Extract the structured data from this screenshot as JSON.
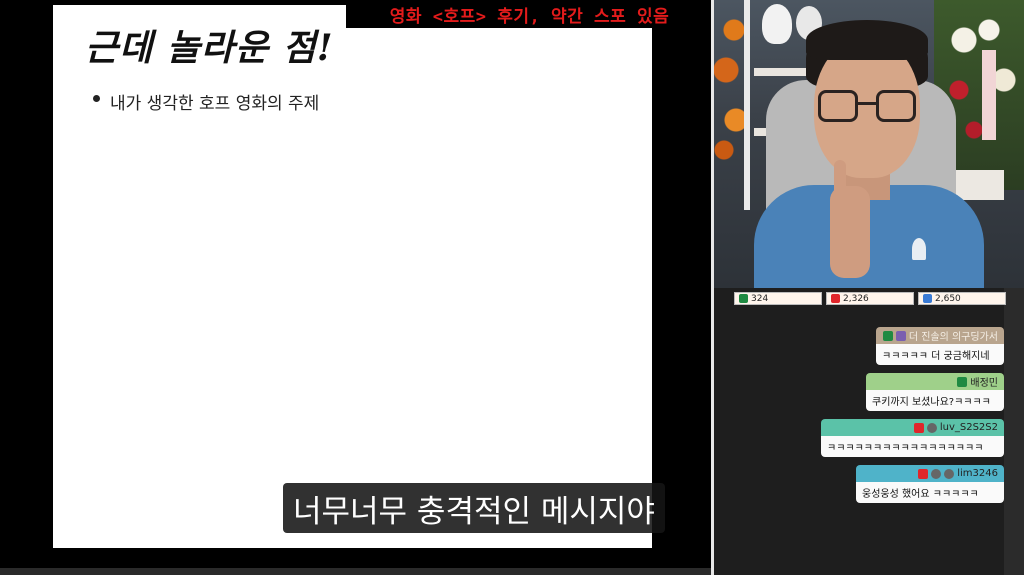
{
  "slide": {
    "title": "근데 놀라운 점!",
    "bullets": [
      "내가 생각한 호프 영화의 주제"
    ]
  },
  "banner": "영화 <호프> 후기, 약간 스포 있음",
  "subtitle": "너무너무 충격적인 메시지야",
  "stats": [
    {
      "icon": "chzzk-icon",
      "value": "324",
      "color": "#1f8a42"
    },
    {
      "icon": "youtube-icon",
      "value": "2,326",
      "color": "#e0262b"
    },
    {
      "icon": "soop-icon",
      "value": "2,650",
      "color": "#3a7bd5"
    }
  ],
  "chat": [
    {
      "user": "더 진솔의 의구딩가서",
      "message": "ㅋㅋㅋㅋㅋ 더 궁금해지네",
      "head_color": "#b9a58e",
      "platform_icons": [
        "chzzk-icon",
        "badge-icon"
      ]
    },
    {
      "user": "배정민",
      "message": "쿠키까지 보셨나요?ㅋㅋㅋㅋ",
      "head_color": "#9fd08a",
      "platform_icons": [
        "chzzk-icon"
      ]
    },
    {
      "user": "luv_S2S2S2",
      "message": "ㅋㅋㅋㅋㅋㅋㅋㅋㅋㅋㅋㅋㅋㅋㅋㅋㅋ",
      "head_color": "#5bc2a8",
      "platform_icons": [
        "youtube-icon",
        "member-icon"
      ]
    },
    {
      "user": "lim3246",
      "message": "웅성웅성 했어요 ㅋㅋㅋㅋㅋ",
      "head_color": "#4fb3c9",
      "platform_icons": [
        "youtube-icon",
        "member-icon",
        "badge-icon"
      ]
    }
  ]
}
